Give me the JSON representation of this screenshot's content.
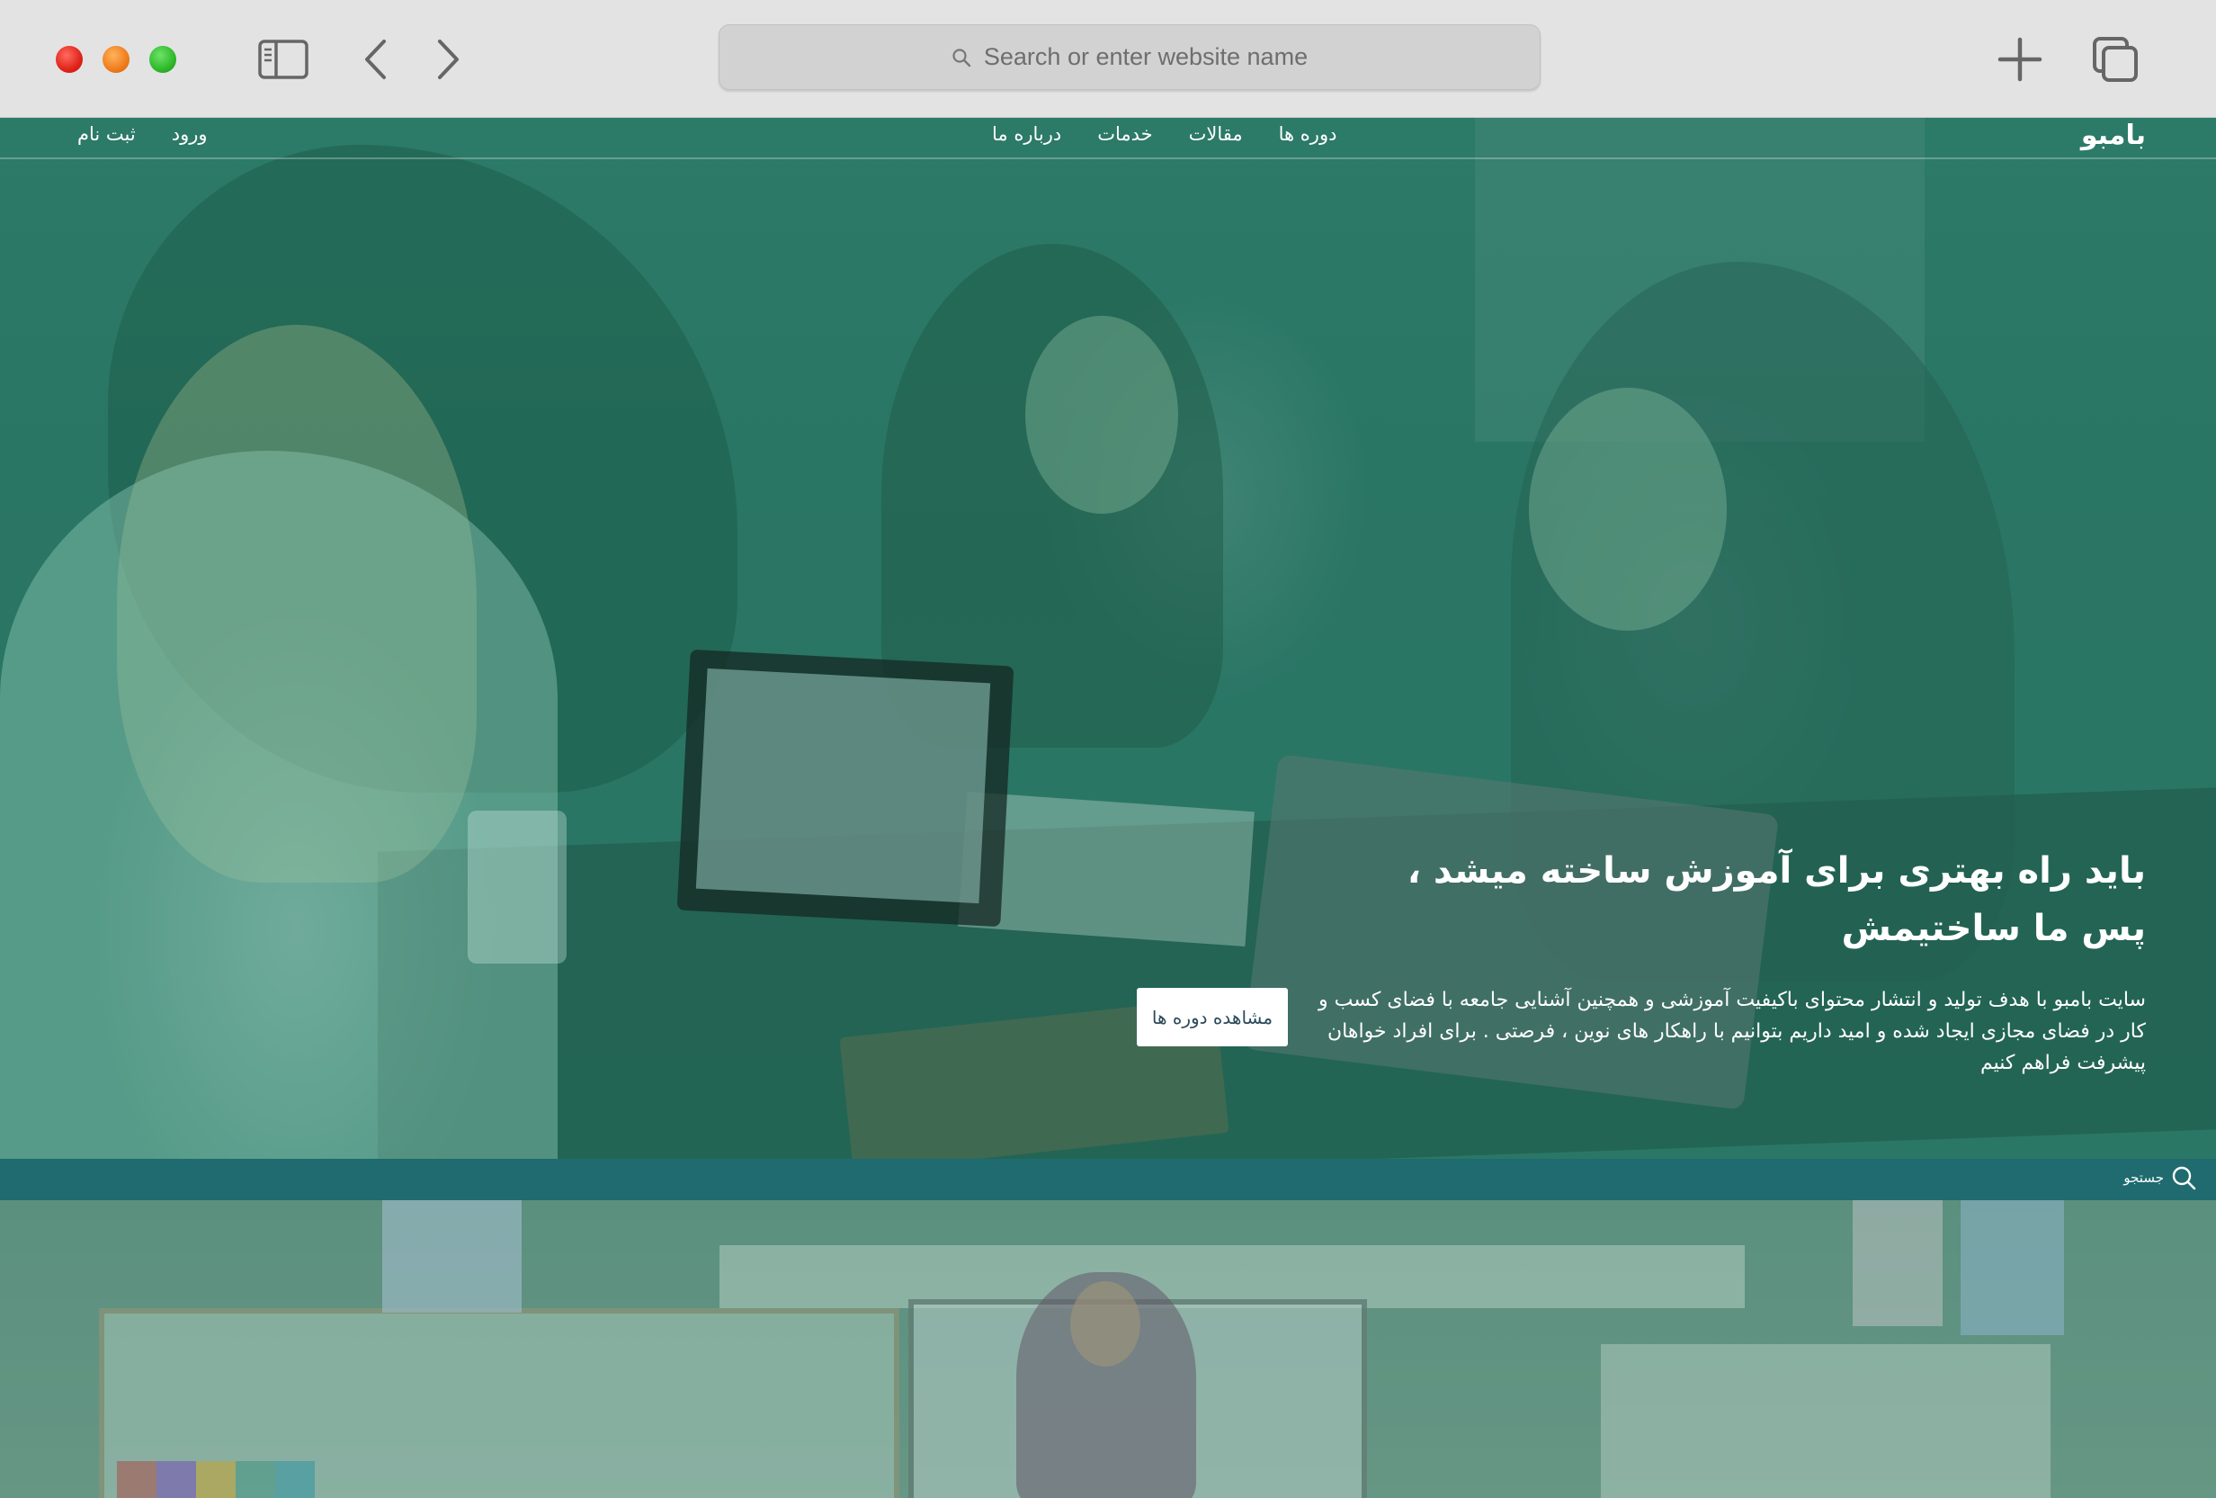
{
  "browser": {
    "url_placeholder": "Search or enter website name"
  },
  "nav": {
    "brand": "بامبو",
    "links": [
      "دوره ها",
      "مقالات",
      "خدمات",
      "درباره ما"
    ],
    "login": "ورود",
    "signup": "ثبت نام"
  },
  "hero": {
    "title": "باید راه بهتری برای آموزش ساخته میشد ، پس ما ساختیمش",
    "description": "سایت بامبو با هدف تولید و انتشار محتوای باکیفیت آموزشی و همچنین آشنایی جامعه با فضای کسب و کار در فضای مجازی ایجاد شده و امید داریم بتوانیم با راهکار های نوین ، فرصتی . برای افراد خواهان پیشرفت فراهم کنیم",
    "cta": "مشاهده دوره ها"
  },
  "search_strip": {
    "label": "جستجو"
  },
  "icons": {
    "search": "search-icon",
    "sidebar": "sidebar-icon",
    "back": "chevron-left-icon",
    "forward": "chevron-right-icon",
    "new_tab": "plus-icon",
    "tabs": "tabs-overview-icon"
  },
  "colors": {
    "hero_overlay": "#2a7564",
    "search_strip": "#1f6b6f",
    "cta_text": "#2c4a5a"
  }
}
